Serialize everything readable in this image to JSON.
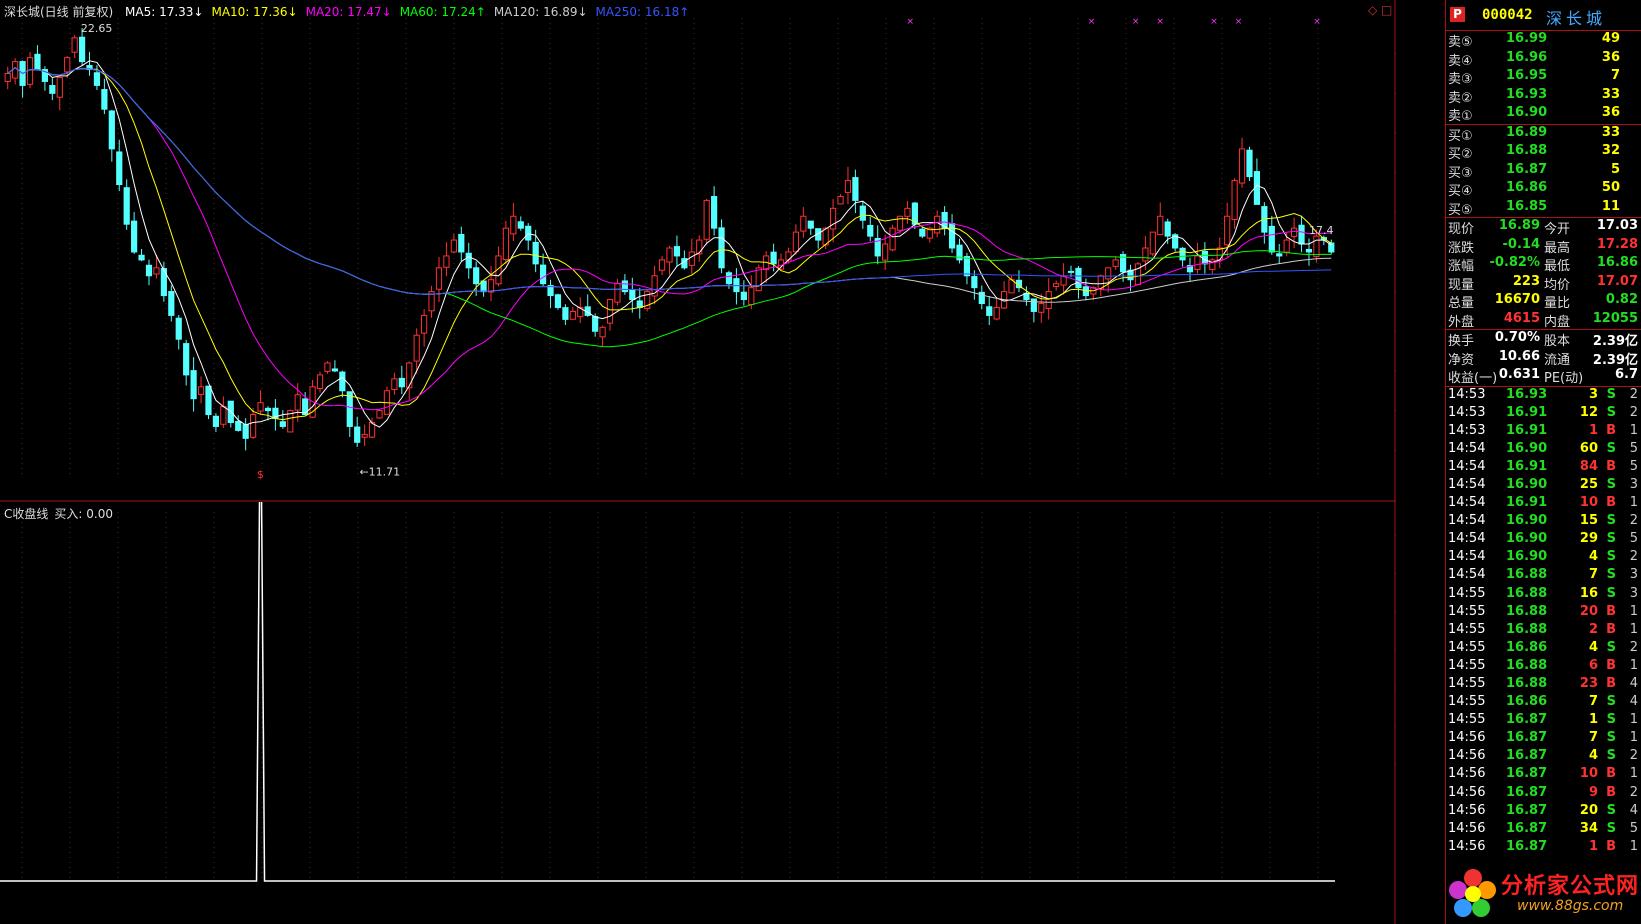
{
  "header": {
    "title": "深长城(日线 前复权)",
    "ma": [
      {
        "label": "MA5: 17.33",
        "arrow": "↓",
        "color": "#ffffff"
      },
      {
        "label": "MA10: 17.36",
        "arrow": "↓",
        "color": "#ffff00"
      },
      {
        "label": "MA20: 17.47",
        "arrow": "↓",
        "color": "#ff00ff"
      },
      {
        "label": "MA60: 17.24",
        "arrow": "↑",
        "color": "#00ff00"
      },
      {
        "label": "MA120: 16.89",
        "arrow": "↓",
        "color": "#cccccc"
      },
      {
        "label": "MA250: 16.18",
        "arrow": "↑",
        "color": "#3355ff"
      }
    ],
    "corner_icons": "◇ □"
  },
  "chart_data": [
    {
      "type": "candlestick",
      "title": "深长城(日线 前复权)",
      "y_ticks": [
        "22.00",
        "21.00",
        "20.00",
        "19.00",
        "18.00",
        "17.00",
        "16.00",
        "15.00",
        "14.00",
        "13.00",
        "12.00"
      ],
      "ylim": [
        11.3,
        22.9
      ],
      "annotations": {
        "high": "22.65",
        "low": "←11.71",
        "last": "17.4"
      },
      "markers": [
        "$",
        "$"
      ],
      "close": [
        21.5,
        21.8,
        21.2,
        21.9,
        21.6,
        21.3,
        21.0,
        21.4,
        21.9,
        22.4,
        21.8,
        21.6,
        21.2,
        20.6,
        19.6,
        18.7,
        17.7,
        17.0,
        16.8,
        16.4,
        16.6,
        15.9,
        15.4,
        14.8,
        13.9,
        13.3,
        13.6,
        12.9,
        12.6,
        13.1,
        12.7,
        12.5,
        12.3,
        12.9,
        13.2,
        13.0,
        12.8,
        12.6,
        13.0,
        13.4,
        12.9,
        13.6,
        13.9,
        14.2,
        14.0,
        13.5,
        12.6,
        12.2,
        12.4,
        12.7,
        13.0,
        13.5,
        13.8,
        13.6,
        14.2,
        14.9,
        15.4,
        16.0,
        16.6,
        16.9,
        17.3,
        17.0,
        16.6,
        16.2,
        16.0,
        16.3,
        16.9,
        17.6,
        17.9,
        17.6,
        17.3,
        16.7,
        16.2,
        15.9,
        15.6,
        15.3,
        15.5,
        15.6,
        15.4,
        15.0,
        15.1,
        15.8,
        16.2,
        16.0,
        15.8,
        15.6,
        16.0,
        16.4,
        16.8,
        17.1,
        16.9,
        16.6,
        17.0,
        17.3,
        18.3,
        17.6,
        16.6,
        16.2,
        16.0,
        15.8,
        16.1,
        16.6,
        16.9,
        16.7,
        16.8,
        17.0,
        17.5,
        17.9,
        17.6,
        17.3,
        17.6,
        18.1,
        18.4,
        18.8,
        18.3,
        17.8,
        17.4,
        16.9,
        17.2,
        17.6,
        17.9,
        18.1,
        17.7,
        17.4,
        17.6,
        17.9,
        17.6,
        17.1,
        16.8,
        16.4,
        16.1,
        15.7,
        15.4,
        15.6,
        16.0,
        16.3,
        16.1,
        15.8,
        15.5,
        15.7,
        16.0,
        16.2,
        16.4,
        16.5,
        16.1,
        15.9,
        16.1,
        16.4,
        16.6,
        16.8,
        16.5,
        16.3,
        16.7,
        17.1,
        17.5,
        17.9,
        17.4,
        17.1,
        16.8,
        16.5,
        16.9,
        16.7,
        16.8,
        17.1,
        17.9,
        18.8,
        19.6,
        18.9,
        18.2,
        17.5,
        17.0,
        16.9,
        17.3,
        17.6,
        17.2,
        17.0,
        17.4,
        17.3,
        17.0
      ],
      "series": [
        {
          "name": "MA5",
          "color": "#ffffff"
        },
        {
          "name": "MA10",
          "color": "#ffff00"
        },
        {
          "name": "MA20",
          "color": "#ff00ff"
        },
        {
          "name": "MA60",
          "color": "#00ff00"
        },
        {
          "name": "MA120",
          "color": "#cccccc"
        },
        {
          "name": "MA250",
          "color": "#3355ff"
        }
      ]
    },
    {
      "type": "line",
      "title": "C收盘线",
      "y_ticks": [
        "1.00",
        "0.90",
        "0.80",
        "0.70",
        "0.60",
        "0.50",
        "0.40",
        "0.30"
      ],
      "ylim": [
        0,
        1
      ],
      "current_value": "0.19",
      "spike_bar": 34,
      "spike_value": 1.0
    }
  ],
  "indicator": {
    "title": "C收盘线",
    "buy_label": "买入: 0.00"
  },
  "quote": {
    "code": "000042",
    "name": "深长城",
    "asks": [
      {
        "label": "卖⑤",
        "price": "16.99",
        "vol": "49"
      },
      {
        "label": "卖④",
        "price": "16.96",
        "vol": "36"
      },
      {
        "label": "卖③",
        "price": "16.95",
        "vol": "7"
      },
      {
        "label": "卖②",
        "price": "16.93",
        "vol": "33"
      },
      {
        "label": "卖①",
        "price": "16.90",
        "vol": "36"
      }
    ],
    "bids": [
      {
        "label": "买①",
        "price": "16.89",
        "vol": "33"
      },
      {
        "label": "买②",
        "price": "16.88",
        "vol": "32"
      },
      {
        "label": "买③",
        "price": "16.87",
        "vol": "5"
      },
      {
        "label": "买④",
        "price": "16.86",
        "vol": "50"
      },
      {
        "label": "买⑤",
        "price": "16.85",
        "vol": "11"
      }
    ],
    "stats": [
      {
        "l1": "现价",
        "v1": "16.89",
        "c1": "#2d2",
        "l2": "今开",
        "v2": "17.03",
        "c2": "#fff"
      },
      {
        "l1": "涨跌",
        "v1": "-0.14",
        "c1": "#2d2",
        "l2": "最高",
        "v2": "17.28",
        "c2": "#f33"
      },
      {
        "l1": "涨幅",
        "v1": "-0.82%",
        "c1": "#2d2",
        "l2": "最低",
        "v2": "16.86",
        "c2": "#2d2"
      },
      {
        "l1": "现量",
        "v1": "223",
        "c1": "#ff0",
        "l2": "均价",
        "v2": "17.07",
        "c2": "#f33"
      },
      {
        "l1": "总量",
        "v1": "16670",
        "c1": "#ff0",
        "l2": "量比",
        "v2": "0.82",
        "c2": "#2d2"
      },
      {
        "l1": "外盘",
        "v1": "4615",
        "c1": "#f33",
        "l2": "内盘",
        "v2": "12055",
        "c2": "#2d2"
      }
    ],
    "stats2": [
      {
        "l1": "换手",
        "v1": "0.70%",
        "c1": "#fff",
        "l2": "股本",
        "v2": "2.39亿",
        "c2": "#fff"
      },
      {
        "l1": "净资",
        "v1": "10.66",
        "c1": "#fff",
        "l2": "流通",
        "v2": "2.39亿",
        "c2": "#fff"
      },
      {
        "l1": "收益(一)",
        "v1": "0.631",
        "c1": "#fff",
        "l2": "PE(动)",
        "v2": "6.7",
        "c2": "#fff"
      }
    ],
    "trades": [
      {
        "t": "14:53",
        "p": "16.93",
        "v": "3",
        "s": "S",
        "n": "2"
      },
      {
        "t": "14:53",
        "p": "16.91",
        "v": "12",
        "s": "S",
        "n": "2"
      },
      {
        "t": "14:53",
        "p": "16.91",
        "v": "1",
        "s": "B",
        "n": "1"
      },
      {
        "t": "14:54",
        "p": "16.90",
        "v": "60",
        "s": "S",
        "n": "5"
      },
      {
        "t": "14:54",
        "p": "16.91",
        "v": "84",
        "s": "B",
        "n": "5"
      },
      {
        "t": "14:54",
        "p": "16.90",
        "v": "25",
        "s": "S",
        "n": "3"
      },
      {
        "t": "14:54",
        "p": "16.91",
        "v": "10",
        "s": "B",
        "n": "1"
      },
      {
        "t": "14:54",
        "p": "16.90",
        "v": "15",
        "s": "S",
        "n": "2"
      },
      {
        "t": "14:54",
        "p": "16.90",
        "v": "29",
        "s": "S",
        "n": "5"
      },
      {
        "t": "14:54",
        "p": "16.90",
        "v": "4",
        "s": "S",
        "n": "2"
      },
      {
        "t": "14:54",
        "p": "16.88",
        "v": "7",
        "s": "S",
        "n": "3"
      },
      {
        "t": "14:55",
        "p": "16.88",
        "v": "16",
        "s": "S",
        "n": "3"
      },
      {
        "t": "14:55",
        "p": "16.88",
        "v": "20",
        "s": "B",
        "n": "1"
      },
      {
        "t": "14:55",
        "p": "16.88",
        "v": "2",
        "s": "B",
        "n": "1"
      },
      {
        "t": "14:55",
        "p": "16.86",
        "v": "4",
        "s": "S",
        "n": "2"
      },
      {
        "t": "14:55",
        "p": "16.88",
        "v": "6",
        "s": "B",
        "n": "1"
      },
      {
        "t": "14:55",
        "p": "16.88",
        "v": "23",
        "s": "B",
        "n": "4"
      },
      {
        "t": "14:55",
        "p": "16.86",
        "v": "7",
        "s": "S",
        "n": "4"
      },
      {
        "t": "14:55",
        "p": "16.87",
        "v": "1",
        "s": "S",
        "n": "1"
      },
      {
        "t": "14:56",
        "p": "16.87",
        "v": "7",
        "s": "S",
        "n": "1"
      },
      {
        "t": "14:56",
        "p": "16.87",
        "v": "4",
        "s": "S",
        "n": "2"
      },
      {
        "t": "14:56",
        "p": "16.87",
        "v": "10",
        "s": "B",
        "n": "1"
      },
      {
        "t": "14:56",
        "p": "16.87",
        "v": "9",
        "s": "B",
        "n": "2"
      },
      {
        "t": "14:56",
        "p": "16.87",
        "v": "20",
        "s": "S",
        "n": "4"
      },
      {
        "t": "14:56",
        "p": "16.87",
        "v": "34",
        "s": "S",
        "n": "5"
      },
      {
        "t": "14:56",
        "p": "16.87",
        "v": "1",
        "s": "B",
        "n": "1"
      }
    ]
  },
  "watermark": {
    "text": "分析家公式网",
    "url": "www.88gs.com"
  }
}
